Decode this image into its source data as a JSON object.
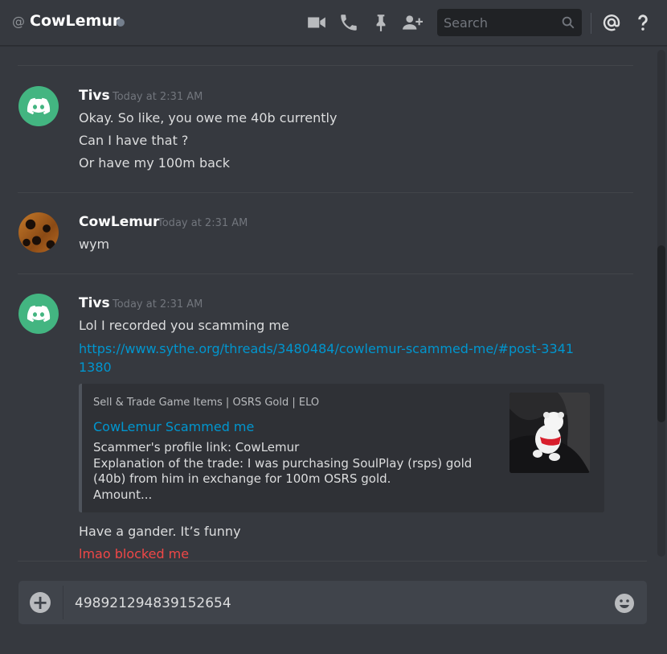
{
  "header": {
    "at_symbol": "@",
    "channel_name": "CowLemur",
    "search_placeholder": "Search",
    "icons": [
      "video-call-icon",
      "voice-call-icon",
      "pin-icon",
      "add-friend-icon",
      "search-icon",
      "mention-icon",
      "help-icon"
    ]
  },
  "messages": [
    {
      "author": "Tivs",
      "timestamp": "Today at 2:31 AM",
      "avatar": "discord-default-avatar",
      "lines": [
        "Okay. So like, you owe me 40b currently",
        "Can I have that ?",
        "Or have my 100m back"
      ]
    },
    {
      "author": "CowLemur",
      "timestamp": "Today at 2:31 AM",
      "avatar": "lemur-avatar",
      "lines": [
        "wym"
      ]
    },
    {
      "author": "Tivs",
      "timestamp": "Today at 2:31 AM",
      "avatar": "discord-default-avatar",
      "lines": [
        "Lol I recorded you scamming me"
      ],
      "link": "https://www.sythe.org/threads/3480484/cowlemur-scammed-me/#post-33411380",
      "embed": {
        "provider": "Sell & Trade Game Items | OSRS Gold | ELO",
        "title": "CowLemur Scammed me",
        "description_lines": [
          "Scammer's profile link: CowLemur",
          "Explanation of the trade: I was purchasing SoulPlay (rsps) gold",
          "(40b) from him in exchange for 100m OSRS gold.",
          "Amount..."
        ]
      },
      "after_lines": [
        "Have a gander. It’s funny"
      ],
      "red_line": "lmao blocked me"
    }
  ],
  "composer": {
    "value": "498921294839152654"
  },
  "colors": {
    "background": "#36393f",
    "link": "#0096cf",
    "error_red": "#f04747",
    "avatar_green": "#43b581"
  }
}
